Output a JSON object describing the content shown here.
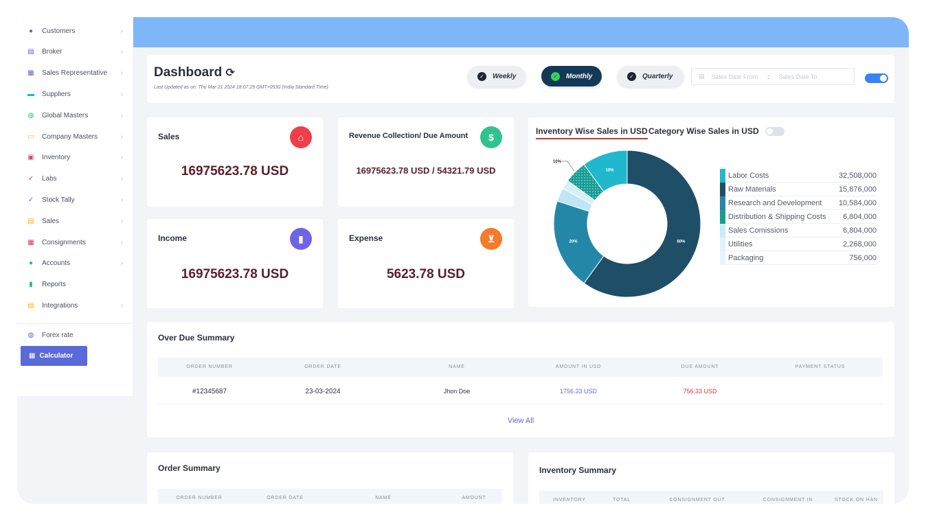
{
  "sidebar": {
    "items": [
      {
        "label": "Customers",
        "icon": "user-icon",
        "color": "#5a6ad9",
        "chevron": true
      },
      {
        "label": "Broker",
        "icon": "broker-icon",
        "color": "#5a6ad9",
        "chevron": true
      },
      {
        "label": "Sales Representative",
        "icon": "sales-rep-icon",
        "color": "#5a6ad9",
        "chevron": true
      },
      {
        "label": "Suppliers",
        "icon": "suppliers-icon",
        "color": "#17b8d0",
        "chevron": true
      },
      {
        "label": "Global Masters",
        "icon": "globe-icon",
        "color": "#28c07a",
        "chevron": true
      },
      {
        "label": "Company Masters",
        "icon": "company-icon",
        "color": "#f5b800",
        "chevron": true
      },
      {
        "label": "Inventory",
        "icon": "inventory-icon",
        "color": "#e0447a",
        "chevron": true
      },
      {
        "label": "Labs",
        "icon": "check-icon",
        "color": "#e0334b",
        "chevron": true
      },
      {
        "label": "Stock Tally",
        "icon": "check-icon",
        "color": "#5a6ad9",
        "chevron": true
      },
      {
        "label": "Sales",
        "icon": "sales-icon",
        "color": "#f5b800",
        "chevron": true
      },
      {
        "label": "Consignments",
        "icon": "consignments-icon",
        "color": "#e0334b",
        "chevron": true
      },
      {
        "label": "Accounts",
        "icon": "user-icon",
        "color": "#17b8d0",
        "chevron": true
      },
      {
        "label": "Reports",
        "icon": "bar-chart-icon",
        "color": "#28c07a",
        "chevron": false
      },
      {
        "label": "Integrations",
        "icon": "integrations-icon",
        "color": "#f5b800",
        "chevron": true
      }
    ],
    "forex_label": "Forex rate",
    "calculator_label": "Calculator"
  },
  "header": {
    "title": "Dashboard",
    "refresh_glyph": "⟳",
    "subtitle": "Last Updated as on: Thu Mar 21 2024 18:07:29 GMT+0530 (India Standard Time)",
    "periods": [
      "Weekly",
      "Monthly",
      "Quarterly"
    ],
    "active_period": "Monthly",
    "date_from_placeholder": "Sales Date From",
    "date_separator": ":",
    "date_to_placeholder": "Sales Date To"
  },
  "stats": {
    "sales": {
      "label": "Sales",
      "value": "16975623.78 USD",
      "color": "#ef3e4a"
    },
    "revenue": {
      "label": "Revenue Collection/ Due Amount",
      "value": "16975623.78 USD / 54321.79 USD",
      "color": "#2fc48d"
    },
    "income": {
      "label": "Income",
      "value": "16975623.78 USD",
      "color": "#6f63e8"
    },
    "expense": {
      "label": "Expense",
      "value": "5623.78 USD",
      "color": "#f57a2a"
    }
  },
  "inventory_chart": {
    "tab_inventory": "Inventory Wise Sales in USD",
    "tab_category": "Category Wise Sales in USD",
    "legend": [
      {
        "label": "Labor Costs",
        "value": "32,508,000",
        "color": "#1fb8cc"
      },
      {
        "label": "Raw Materials",
        "value": "15,876,000",
        "color": "#1f4f66"
      },
      {
        "label": "Research and Development",
        "value": "10,584,000",
        "color": "#2388a8"
      },
      {
        "label": "Distribution & Shipping Costs",
        "value": "6,804,000",
        "color": "#1a9c94"
      },
      {
        "label": "Sales Comissions",
        "value": "6,804,000",
        "color": "#c8ecf7"
      },
      {
        "label": "Utilities",
        "value": "2,268,000",
        "color": "#dff3fa"
      },
      {
        "label": "Packaging",
        "value": "756,000",
        "color": "#e4f5fb"
      }
    ]
  },
  "chart_data": {
    "type": "pie",
    "title": "Inventory Wise Sales in USD",
    "categories": [
      "Raw Materials",
      "Research and Development",
      "Sales Comissions",
      "Utilities",
      "Distribution & Shipping Costs",
      "Labor Costs"
    ],
    "values": [
      60,
      20,
      3,
      2,
      5,
      10
    ],
    "data_labels": [
      "60%",
      "20%",
      "",
      "",
      "10%",
      "10%"
    ],
    "colors": [
      "#1f4f66",
      "#2388a8",
      "#bfe6f4",
      "#d8f0f8",
      "#1a9c94",
      "#1fb8cc"
    ]
  },
  "overdue": {
    "title": "Over Due Summary",
    "columns": [
      "ORDER NUMBER",
      "ORDER DATE",
      "NAME",
      "AMOUNT IN USD",
      "DUE AMOUNT",
      "PAYMENT STATUS"
    ],
    "rows": [
      {
        "order_number": "#12345687",
        "order_date": "23-03-2024",
        "name": "Jhon Doe",
        "amount": "1756.33 USD",
        "due": "756.33 USD",
        "status": ""
      }
    ],
    "view_all": "View All"
  },
  "order_summary": {
    "title": "Order Summary",
    "columns": [
      "ORDER NUMBER",
      "ORDER DATE",
      "NAME",
      "AMOUNT"
    ]
  },
  "inventory_summary": {
    "title": "Inventory Summary",
    "columns": [
      "INVENTORY",
      "TOTAL",
      "CONSIGNMENT OUT",
      "CONSIGNMENT IN",
      "STOCK ON HAN"
    ]
  }
}
